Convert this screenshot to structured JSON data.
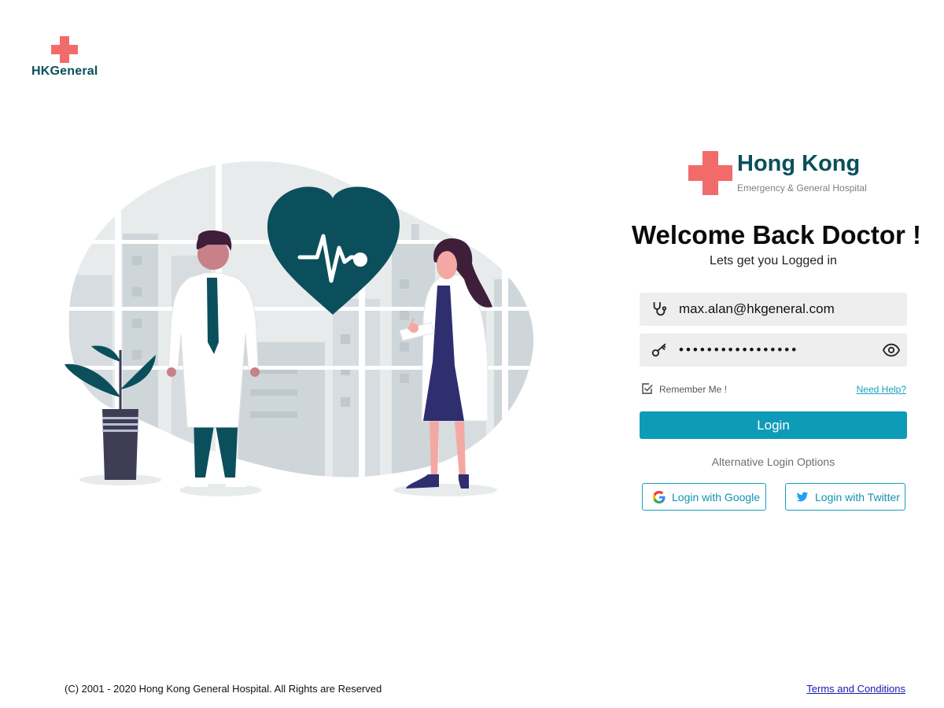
{
  "header": {
    "logo_text": "HKGeneral"
  },
  "brand": {
    "title": "Hong Kong",
    "subtitle": "Emergency & General Hospital"
  },
  "login": {
    "heading": "Welcome Back Doctor !",
    "subheading": "Lets get you Logged in",
    "email_value": "max.alan@hkgeneral.com",
    "password_masked": "•••••••••••••••••",
    "remember_label": "Remember Me !",
    "remember_checked": true,
    "help_link": "Need Help?",
    "login_button": "Login",
    "alt_label": "Alternative Login Options",
    "google_button": "Login with Google",
    "twitter_button": "Login with Twitter"
  },
  "icons": {
    "logo": "red-cross-icon",
    "email": "stethoscope-icon",
    "password": "key-icon",
    "show_password": "eye-icon",
    "remember": "checkbox-icon",
    "google": "google-icon",
    "twitter": "twitter-icon"
  },
  "footer": {
    "copyright": "(C) 2001 - 2020 Hong Kong General Hospital. All Rights are Reserved",
    "terms_link": "Terms and Conditions"
  },
  "colors": {
    "brand_red": "#f26b6b",
    "brand_teal": "#0b4f5c",
    "accent": "#0d9bb8",
    "field_bg": "#efeeee"
  }
}
